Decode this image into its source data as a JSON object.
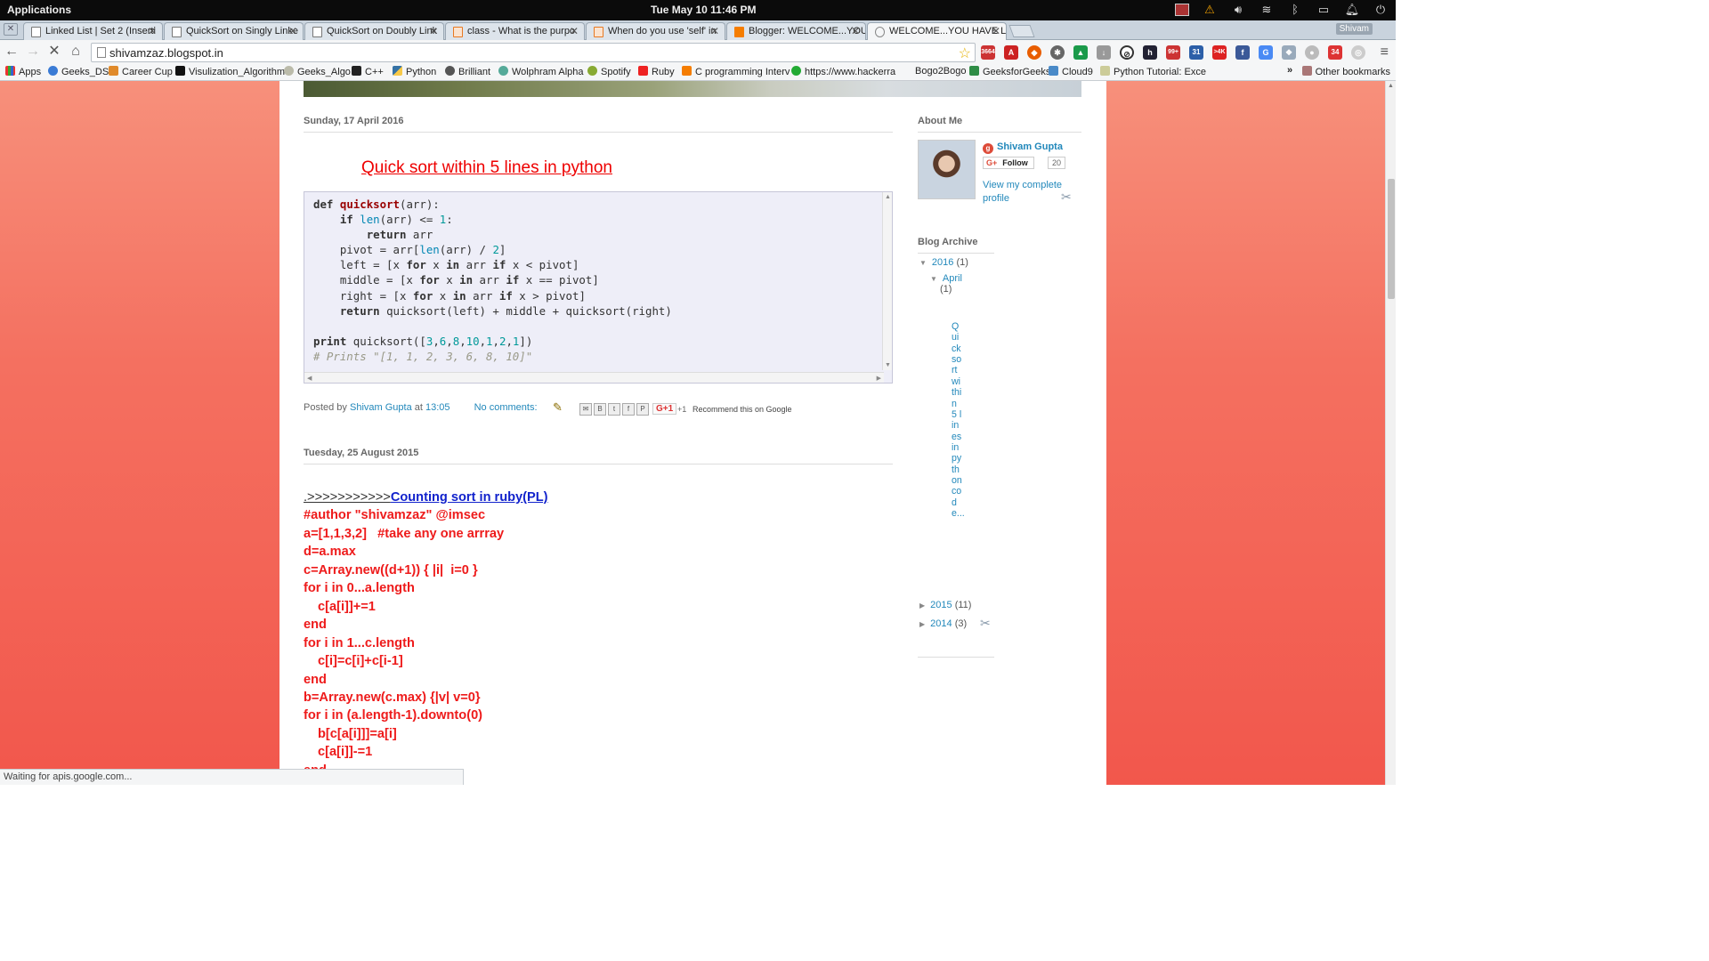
{
  "os": {
    "apps_label": "Applications",
    "datetime": "Tue May 10    11:46 PM"
  },
  "tabs": [
    {
      "title": "Linked List | Set 2 (Inserti"
    },
    {
      "title": "QuickSort on Singly Linke"
    },
    {
      "title": "QuickSort on Doubly Link"
    },
    {
      "title": "class - What is the purpo"
    },
    {
      "title": "When do you use 'self' in"
    },
    {
      "title": "Blogger: WELCOME...YOU"
    },
    {
      "title": "WELCOME...YOU HAVE LA"
    }
  ],
  "profile_name": "Shivam",
  "address": {
    "url": "shivamzaz.blogspot.in"
  },
  "extensions": {
    "gmail_count": "3664",
    "badge_99": "99+",
    "badge_31": "31",
    "badge_3k": ">4K",
    "badge_34": "34"
  },
  "bookmarks": [
    {
      "label": "Apps"
    },
    {
      "label": "Geeks_DS"
    },
    {
      "label": "Career Cup"
    },
    {
      "label": "Visulization_Algorithm"
    },
    {
      "label": "Geeks_Algo"
    },
    {
      "label": "C++"
    },
    {
      "label": "Python"
    },
    {
      "label": "Brilliant"
    },
    {
      "label": "Wolphram Alpha"
    },
    {
      "label": "Spotify"
    },
    {
      "label": "Ruby"
    },
    {
      "label": "C programming Interv"
    },
    {
      "label": "https://www.hackerra"
    },
    {
      "label": "Bogo2Bogo"
    },
    {
      "label": "GeeksforGeeks"
    },
    {
      "label": "Cloud9"
    },
    {
      "label": "Python Tutorial: Exce"
    }
  ],
  "bookmarks_other": "Other bookmarks",
  "post1": {
    "date": "Sunday, 17 April 2016",
    "title": "Quick sort within 5 lines in python",
    "footer": {
      "posted_by": "Posted by",
      "author": "Shivam Gupta",
      "at": "at",
      "time": "13:05",
      "comments": "No comments:",
      "plus_one": "+1",
      "recommend": "Recommend this on Google"
    }
  },
  "post2": {
    "date": "Tuesday, 25 August 2015",
    "title_prefix": ".>>>>>>>>>>>",
    "title_link": "Counting sort in ruby(PL)",
    "lines": [
      "#author \"shivamzaz\" @imsec",
      "a=[1,1,3,2]   #take any one arrray",
      "d=a.max",
      "c=Array.new((d+1)) { |i|  i=0 }",
      "for i in 0...a.length",
      "c[a[i]]+=1",
      "end",
      "for i in 1...c.length",
      "c[i]=c[i]+c[i-1]",
      "end",
      "b=Array.new(c.max) {|v| v=0}",
      "for i in (a.length-1).downto(0)",
      "b[c[a[i]]]=a[i]",
      "c[a[i]]-=1",
      "end"
    ]
  },
  "sidebar": {
    "about_heading": "About Me",
    "profile_name": "Shivam Gupta",
    "follow_label": "Follow",
    "follow_count": "20",
    "view_profile": "View my complete profile",
    "archive_heading": "Blog Archive",
    "archive": {
      "y2016": "2016",
      "y2016_count": "(1)",
      "april": "April",
      "april_count": "(1)",
      "post_title": "Quick sort within 5 lines in python code...",
      "y2015": "2015",
      "y2015_count": "(11)",
      "y2014": "2014",
      "y2014_count": "(3)"
    }
  },
  "status_text": "Waiting for apis.google.com..."
}
